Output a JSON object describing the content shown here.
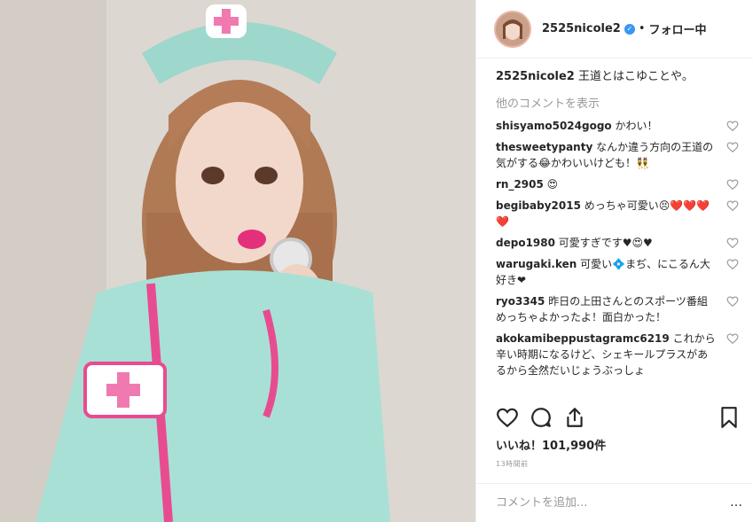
{
  "post": {
    "username": "2525nicole2",
    "verified_mark": "✓",
    "separator": "•",
    "follow_status": "フォロー中",
    "caption_user": "2525nicole2",
    "caption_text": " 王道とはこゆことや。",
    "view_more": "他のコメントを表示",
    "likes": "いいね！101,990件",
    "time": "13時間前",
    "add_comment_placeholder": "コメントを追加...",
    "more_dots": "…"
  },
  "comments": [
    {
      "user": "shisyamo5024gogo",
      "text": " かわい！"
    },
    {
      "user": "thesweetypanty",
      "text": " なんか違う方向の王道の気がする😂かわいいけども！👯"
    },
    {
      "user": "rn_2905",
      "text": " 😍"
    },
    {
      "user": "begibaby2015",
      "text": " めっちゃ可愛い😣❤️❤️❤️❤️"
    },
    {
      "user": "depo1980",
      "text": " 可愛すぎです♥😍♥"
    },
    {
      "user": "warugaki.ken",
      "text": " 可愛い💠まぢ、にこるん大好き❤"
    },
    {
      "user": "ryo3345",
      "text": " 昨日の上田さんとのスポーツ番組めっちゃよかったよ！面白かった！"
    },
    {
      "user": "akokamibeppustagramc6219",
      "text": " これから辛い時期になるけど、シェキールプラスがあるから全然だいじょうぶっしょ"
    }
  ],
  "icons": {
    "like": "heart-icon",
    "comment": "comment-icon",
    "share": "share-icon",
    "save": "bookmark-icon"
  }
}
